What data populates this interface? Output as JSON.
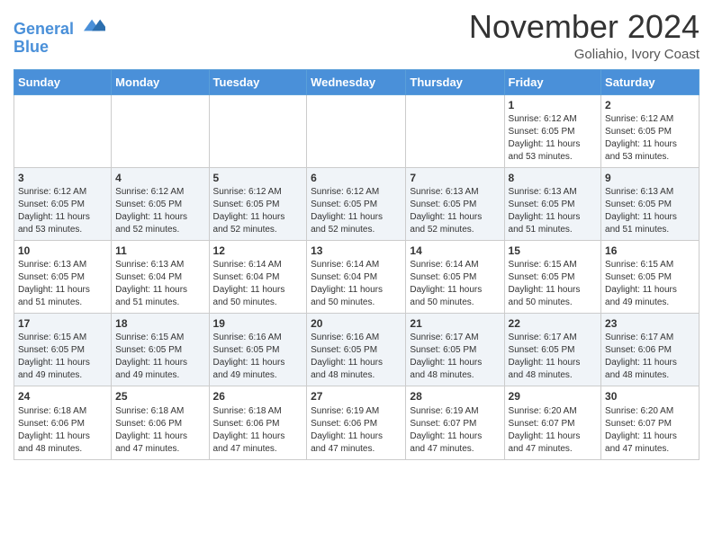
{
  "header": {
    "logo_line1": "General",
    "logo_line2": "Blue",
    "month": "November 2024",
    "location": "Goliahio, Ivory Coast"
  },
  "weekdays": [
    "Sunday",
    "Monday",
    "Tuesday",
    "Wednesday",
    "Thursday",
    "Friday",
    "Saturday"
  ],
  "weeks": [
    [
      {
        "day": "",
        "info": ""
      },
      {
        "day": "",
        "info": ""
      },
      {
        "day": "",
        "info": ""
      },
      {
        "day": "",
        "info": ""
      },
      {
        "day": "",
        "info": ""
      },
      {
        "day": "1",
        "info": "Sunrise: 6:12 AM\nSunset: 6:05 PM\nDaylight: 11 hours\nand 53 minutes."
      },
      {
        "day": "2",
        "info": "Sunrise: 6:12 AM\nSunset: 6:05 PM\nDaylight: 11 hours\nand 53 minutes."
      }
    ],
    [
      {
        "day": "3",
        "info": "Sunrise: 6:12 AM\nSunset: 6:05 PM\nDaylight: 11 hours\nand 53 minutes."
      },
      {
        "day": "4",
        "info": "Sunrise: 6:12 AM\nSunset: 6:05 PM\nDaylight: 11 hours\nand 52 minutes."
      },
      {
        "day": "5",
        "info": "Sunrise: 6:12 AM\nSunset: 6:05 PM\nDaylight: 11 hours\nand 52 minutes."
      },
      {
        "day": "6",
        "info": "Sunrise: 6:12 AM\nSunset: 6:05 PM\nDaylight: 11 hours\nand 52 minutes."
      },
      {
        "day": "7",
        "info": "Sunrise: 6:13 AM\nSunset: 6:05 PM\nDaylight: 11 hours\nand 52 minutes."
      },
      {
        "day": "8",
        "info": "Sunrise: 6:13 AM\nSunset: 6:05 PM\nDaylight: 11 hours\nand 51 minutes."
      },
      {
        "day": "9",
        "info": "Sunrise: 6:13 AM\nSunset: 6:05 PM\nDaylight: 11 hours\nand 51 minutes."
      }
    ],
    [
      {
        "day": "10",
        "info": "Sunrise: 6:13 AM\nSunset: 6:05 PM\nDaylight: 11 hours\nand 51 minutes."
      },
      {
        "day": "11",
        "info": "Sunrise: 6:13 AM\nSunset: 6:04 PM\nDaylight: 11 hours\nand 51 minutes."
      },
      {
        "day": "12",
        "info": "Sunrise: 6:14 AM\nSunset: 6:04 PM\nDaylight: 11 hours\nand 50 minutes."
      },
      {
        "day": "13",
        "info": "Sunrise: 6:14 AM\nSunset: 6:04 PM\nDaylight: 11 hours\nand 50 minutes."
      },
      {
        "day": "14",
        "info": "Sunrise: 6:14 AM\nSunset: 6:05 PM\nDaylight: 11 hours\nand 50 minutes."
      },
      {
        "day": "15",
        "info": "Sunrise: 6:15 AM\nSunset: 6:05 PM\nDaylight: 11 hours\nand 50 minutes."
      },
      {
        "day": "16",
        "info": "Sunrise: 6:15 AM\nSunset: 6:05 PM\nDaylight: 11 hours\nand 49 minutes."
      }
    ],
    [
      {
        "day": "17",
        "info": "Sunrise: 6:15 AM\nSunset: 6:05 PM\nDaylight: 11 hours\nand 49 minutes."
      },
      {
        "day": "18",
        "info": "Sunrise: 6:15 AM\nSunset: 6:05 PM\nDaylight: 11 hours\nand 49 minutes."
      },
      {
        "day": "19",
        "info": "Sunrise: 6:16 AM\nSunset: 6:05 PM\nDaylight: 11 hours\nand 49 minutes."
      },
      {
        "day": "20",
        "info": "Sunrise: 6:16 AM\nSunset: 6:05 PM\nDaylight: 11 hours\nand 48 minutes."
      },
      {
        "day": "21",
        "info": "Sunrise: 6:17 AM\nSunset: 6:05 PM\nDaylight: 11 hours\nand 48 minutes."
      },
      {
        "day": "22",
        "info": "Sunrise: 6:17 AM\nSunset: 6:05 PM\nDaylight: 11 hours\nand 48 minutes."
      },
      {
        "day": "23",
        "info": "Sunrise: 6:17 AM\nSunset: 6:06 PM\nDaylight: 11 hours\nand 48 minutes."
      }
    ],
    [
      {
        "day": "24",
        "info": "Sunrise: 6:18 AM\nSunset: 6:06 PM\nDaylight: 11 hours\nand 48 minutes."
      },
      {
        "day": "25",
        "info": "Sunrise: 6:18 AM\nSunset: 6:06 PM\nDaylight: 11 hours\nand 47 minutes."
      },
      {
        "day": "26",
        "info": "Sunrise: 6:18 AM\nSunset: 6:06 PM\nDaylight: 11 hours\nand 47 minutes."
      },
      {
        "day": "27",
        "info": "Sunrise: 6:19 AM\nSunset: 6:06 PM\nDaylight: 11 hours\nand 47 minutes."
      },
      {
        "day": "28",
        "info": "Sunrise: 6:19 AM\nSunset: 6:07 PM\nDaylight: 11 hours\nand 47 minutes."
      },
      {
        "day": "29",
        "info": "Sunrise: 6:20 AM\nSunset: 6:07 PM\nDaylight: 11 hours\nand 47 minutes."
      },
      {
        "day": "30",
        "info": "Sunrise: 6:20 AM\nSunset: 6:07 PM\nDaylight: 11 hours\nand 47 minutes."
      }
    ]
  ]
}
